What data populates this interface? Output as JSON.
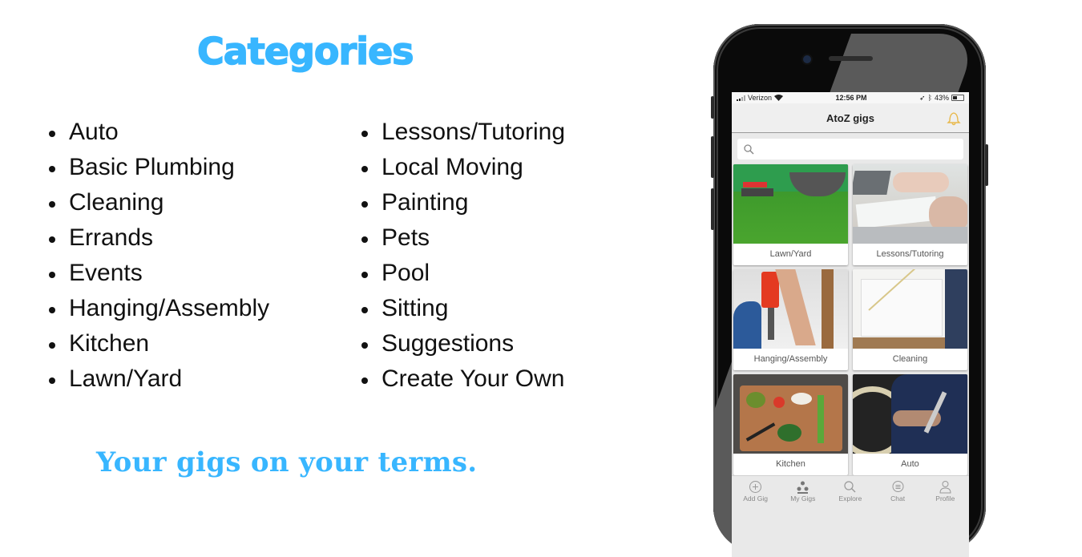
{
  "heading": "Categories",
  "categories": {
    "column1": [
      "Auto",
      "Basic Plumbing",
      "Cleaning",
      "Errands",
      "Events",
      "Hanging/Assembly",
      "Kitchen",
      "Lawn/Yard"
    ],
    "column2": [
      "Lessons/Tutoring",
      "Local Moving",
      "Painting",
      "Pets",
      "Pool",
      "Sitting",
      "Suggestions",
      "Create Your Own"
    ]
  },
  "tagline": "Your gigs on your terms.",
  "colors": {
    "accent": "#38b6ff",
    "bell": "#e8b84a"
  },
  "phone": {
    "status_bar": {
      "carrier": "Verizon",
      "time": "12:56 PM",
      "battery": "43%"
    },
    "app_title": "AtoZ gigs",
    "search": {
      "placeholder": "",
      "icon": "search-icon"
    },
    "notification_icon": "bell-icon",
    "tiles": [
      {
        "label": "Lawn/Yard",
        "image": "lawn-mower-grass"
      },
      {
        "label": "Lessons/Tutoring",
        "image": "laptop-writing"
      },
      {
        "label": "Hanging/Assembly",
        "image": "power-drill"
      },
      {
        "label": "Cleaning",
        "image": "mopping-kitchen"
      },
      {
        "label": "Kitchen",
        "image": "cutting-board-vegetables"
      },
      {
        "label": "Auto",
        "image": "mechanic-wrench-wheel"
      }
    ],
    "tabs": [
      {
        "label": "Add Gig",
        "icon": "plus-circle-icon"
      },
      {
        "label": "My Gigs",
        "icon": "people-icon"
      },
      {
        "label": "Explore",
        "icon": "search-icon"
      },
      {
        "label": "Chat",
        "icon": "chat-bubble-icon"
      },
      {
        "label": "Profile",
        "icon": "person-icon"
      }
    ]
  }
}
